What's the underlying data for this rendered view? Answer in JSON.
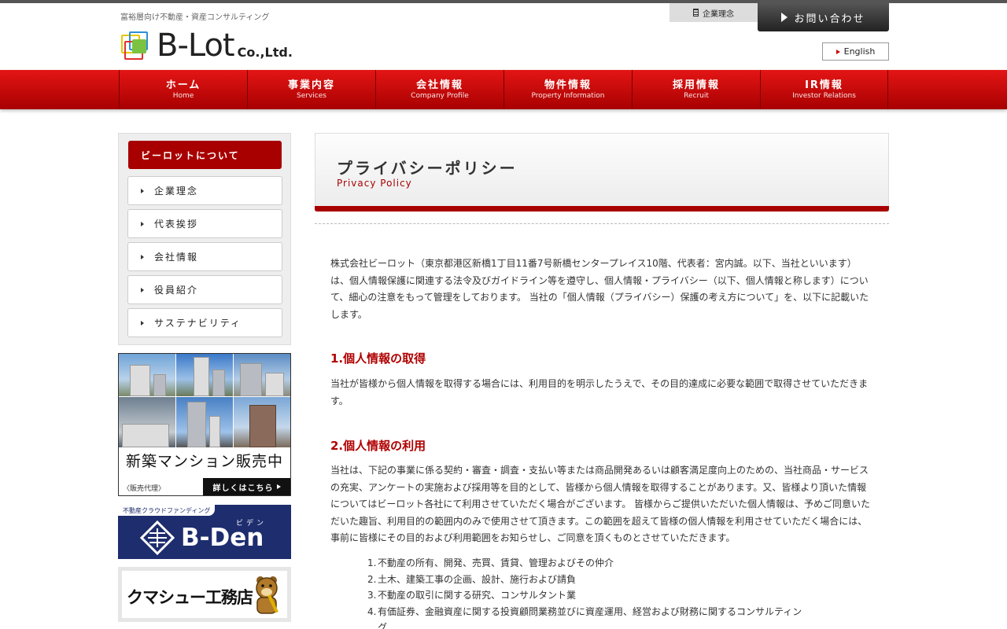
{
  "header": {
    "tagline": "富裕層向け不動産・資産コンサルティング",
    "logo_text": "B-Lot",
    "logo_sub": "Co.,Ltd.",
    "philosophy_label": "企業理念",
    "contact_label": "お問い合わせ",
    "english_label": "English"
  },
  "nav": [
    {
      "ja": "ホーム",
      "en": "Home"
    },
    {
      "ja": "事業内容",
      "en": "Services"
    },
    {
      "ja": "会社情報",
      "en": "Company Profile"
    },
    {
      "ja": "物件情報",
      "en": "Property Information"
    },
    {
      "ja": "採用情報",
      "en": "Recruit"
    },
    {
      "ja": "IR情報",
      "en": "Investor Relations"
    }
  ],
  "sidebar": {
    "heading": "ビーロットについて",
    "items": [
      {
        "label": "企業理念"
      },
      {
        "label": "代表挨拶"
      },
      {
        "label": "会社情報"
      },
      {
        "label": "役員紹介"
      },
      {
        "label": "サステナビリティ"
      }
    ]
  },
  "banners": {
    "mansion_title": "新築マンション販売中",
    "mansion_agent": "〈販売代理〉",
    "mansion_more": "詳しくはこちら",
    "bden_top": "不動産クラウドファンディング",
    "bden_ruby": "ビデン",
    "bden_logo": "B-Den",
    "kuma_text": "クマシュー工務店"
  },
  "page": {
    "title": "プライバシーポリシー",
    "subtitle": "Privacy Policy",
    "intro": "株式会社ビーロット（東京都港区新橋1丁目11番7号新橋センタープレイス10階、代表者：宮内誠。以下、当社といいます）は、個人情報保護に関連する法令及びガイドライン等を遵守し、個人情報・プライバシー（以下、個人情報と称します）について、細心の注意をもって管理をしております。 当社の「個人情報（プライバシー）保護の考え方について」を、以下に記載いたします。",
    "section1_title": "1.個人情報の取得",
    "section1_body": "当社が皆様から個人情報を取得する場合には、利用目的を明示したうえで、その目的達成に必要な範囲で取得させていただきます。",
    "section2_title": "2.個人情報の利用",
    "section2_body": "当社は、下記の事業に係る契約・審査・調査・支払い等または商品開発あるいは顧客満足度向上のための、当社商品・サービスの充実、アンケートの実施および採用等を目的として、皆様から個人情報を取得することがあります。又、皆様より頂いた情報についてはビーロット各社にて利用させていただく場合がございます。 皆様からご提供いただいた個人情報は、予めご同意いただいた趣旨、利用目的の範囲内のみで使用させて頂きます。この範囲を超えて皆様の個人情報を利用させていただく場合には、事前に皆様にその目的および利用範囲をお知らせし、ご同意を頂くものとさせていただきます。",
    "list": [
      {
        "num": "1.",
        "text": "不動産の所有、開発、売買、賃貸、管理およびその仲介"
      },
      {
        "num": "2.",
        "text": "土木、建築工事の企画、設計、施行および請負"
      },
      {
        "num": "3.",
        "text": "不動産の取引に関する研究、コンサルタント業"
      },
      {
        "num": "4.",
        "text": "有価証券、金融資産に関する投資顧問業務並びに資産運用、経営および財務に関するコンサルティング"
      }
    ]
  }
}
